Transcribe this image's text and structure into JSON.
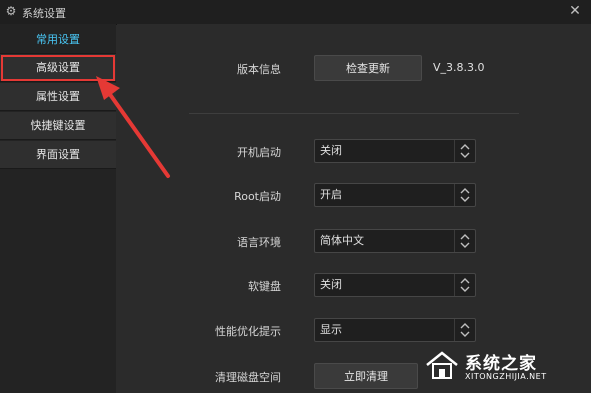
{
  "window": {
    "title": "系统设置",
    "close_glyph": "✕"
  },
  "sidebar": {
    "items": [
      {
        "label": "常用设置"
      },
      {
        "label": "高级设置"
      },
      {
        "label": "属性设置"
      },
      {
        "label": "快捷键设置"
      },
      {
        "label": "界面设置"
      }
    ]
  },
  "settings": {
    "version_label": "版本信息",
    "check_update": "检查更新",
    "version": "V_3.8.3.0",
    "rows": [
      {
        "label": "开机启动",
        "value": "关闭"
      },
      {
        "label": "Root启动",
        "value": "开启"
      },
      {
        "label": "语言环境",
        "value": "简体中文"
      },
      {
        "label": "软键盘",
        "value": "关闭"
      },
      {
        "label": "性能优化提示",
        "value": "显示"
      }
    ],
    "clean_label": "清理磁盘空间",
    "clean_button": "立即清理"
  },
  "watermark": {
    "brand": "系统之家",
    "url": "XITONGZHIJIA.NET"
  },
  "colors": {
    "accent": "#49c7f5",
    "highlight": "#e53935"
  }
}
